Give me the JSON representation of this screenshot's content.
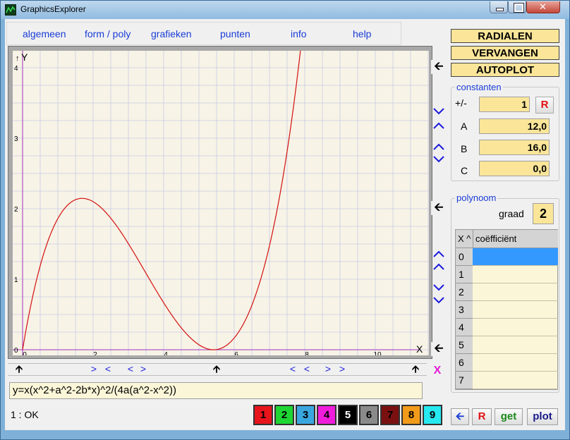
{
  "window": {
    "title": "GraphicsExplorer"
  },
  "menu": {
    "items": [
      {
        "label": "algemeen"
      },
      {
        "label": "form / poly"
      },
      {
        "label": "grafieken"
      },
      {
        "label": "punten"
      },
      {
        "label": "info"
      },
      {
        "label": "help"
      }
    ]
  },
  "plot": {
    "y_axis_label": "Y",
    "x_axis_label": "X",
    "y_arrow": "↑",
    "y_ticks": [
      "4",
      "3",
      "2",
      "1",
      "0"
    ],
    "x_ticks": [
      "0",
      "2",
      "4",
      "6",
      "8",
      "10"
    ],
    "curve_color": "#d41010",
    "axis_color": "#a030c0",
    "grid_color": "#c9cbe6"
  },
  "buttons": {
    "radialen": "RADIALEN",
    "vervangen": "VERVANGEN",
    "autoplot": "AUTOPLOT"
  },
  "constants": {
    "title": "constanten",
    "plusminus_label": "+/-",
    "plusminus_value": "1",
    "reset_label": "R",
    "a_label": "A",
    "a_value": "12,0",
    "b_label": "B",
    "b_value": "16,0",
    "c_label": "C",
    "c_value": "0,0"
  },
  "polynoom": {
    "title": "polynoom",
    "graad_label": "graad",
    "graad_value": "2",
    "col_x": "X ^",
    "col_coef": "coëfficiënt",
    "rows": [
      "0",
      "1",
      "2",
      "3",
      "4",
      "5",
      "6",
      "7"
    ]
  },
  "formula": {
    "value": "y=x(x^2+a^2-2b*x)^2/(4a(a^2-x^2))"
  },
  "status": {
    "text": "1 : OK"
  },
  "colors": [
    {
      "label": "1",
      "bg": "#e8141c",
      "fg": "#000000"
    },
    {
      "label": "2",
      "bg": "#1ed633",
      "fg": "#000000"
    },
    {
      "label": "3",
      "bg": "#3aa6e0",
      "fg": "#000000"
    },
    {
      "label": "4",
      "bg": "#f01cdc",
      "fg": "#000000"
    },
    {
      "label": "5",
      "bg": "#000000",
      "fg": "#ffffff"
    },
    {
      "label": "6",
      "bg": "#8a8a8a",
      "fg": "#000000"
    },
    {
      "label": "7",
      "bg": "#7a1010",
      "fg": "#000000"
    },
    {
      "label": "8",
      "bg": "#f29a1a",
      "fg": "#000000"
    },
    {
      "label": "9",
      "bg": "#26e8f0",
      "fg": "#000000"
    }
  ],
  "actions": {
    "back_icon": "arrow-left-icon",
    "reset": "R",
    "get": "get",
    "plot": "plot"
  },
  "misc": {
    "x_close": "X"
  }
}
